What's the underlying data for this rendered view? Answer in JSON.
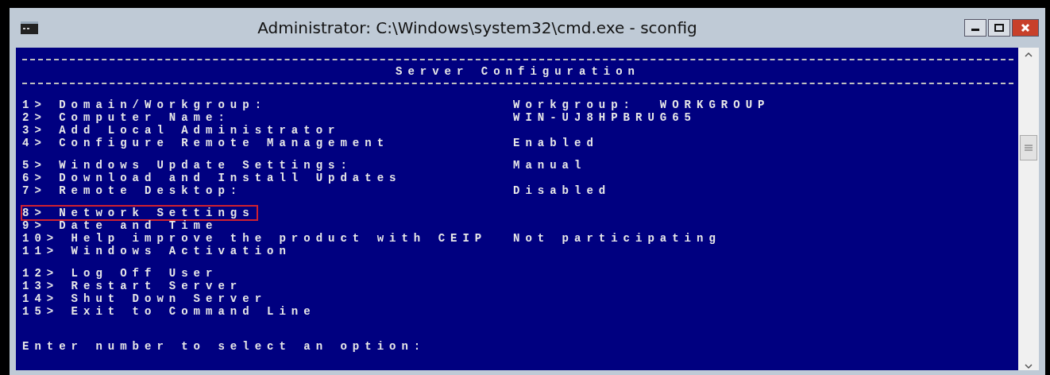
{
  "window": {
    "title": "Administrator: C:\\Windows\\system32\\cmd.exe - sconfig"
  },
  "console": {
    "heading": "Server Configuration",
    "groups": [
      [
        {
          "label": "1> Domain/Workgroup:",
          "value": "Workgroup:  WORKGROUP",
          "highlighted": false
        },
        {
          "label": "2> Computer Name:",
          "value": "WIN-UJ8HPBRUG65",
          "highlighted": false
        },
        {
          "label": "3> Add Local Administrator",
          "highlighted": false
        },
        {
          "label": "4> Configure Remote Management",
          "value": "Enabled",
          "highlighted": false
        }
      ],
      [
        {
          "label": "5> Windows Update Settings:",
          "value": "Manual",
          "highlighted": false
        },
        {
          "label": "6> Download and Install Updates",
          "highlighted": false
        },
        {
          "label": "7> Remote Desktop:",
          "value": "Disabled",
          "highlighted": false
        }
      ],
      [
        {
          "label": "8> Network Settings",
          "highlighted": true
        },
        {
          "label": "9> Date and Time",
          "highlighted": false
        },
        {
          "label": "10> Help improve the product with CEIP",
          "value": "Not participating",
          "highlighted": false
        },
        {
          "label": "11> Windows Activation",
          "highlighted": false
        }
      ],
      [
        {
          "label": "12> Log Off User",
          "highlighted": false
        },
        {
          "label": "13> Restart Server",
          "highlighted": false
        },
        {
          "label": "14> Shut Down Server",
          "highlighted": false
        },
        {
          "label": "15> Exit to Command Line",
          "highlighted": false
        }
      ]
    ],
    "prompt": "Enter number to select an option:"
  }
}
